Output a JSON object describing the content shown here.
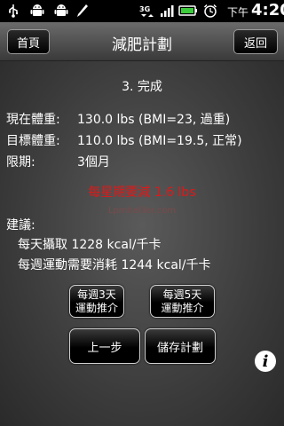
{
  "status_bar": {
    "icons": [
      "usb-icon",
      "android-icon",
      "android-icon",
      "pen-icon",
      "3g-icon",
      "signal-icon",
      "battery-icon",
      "alarm-icon"
    ],
    "network_label": "3G",
    "ampm": "下午",
    "time": "4:20",
    "battery_color": "#3ccc3c"
  },
  "title_bar": {
    "title": "減肥計劃",
    "home_label": "首頁",
    "back_label": "返回"
  },
  "content": {
    "step": "3. 完成",
    "current": {
      "label": "現在體重:",
      "value": "130.0 lbs (BMI=23, 過重)"
    },
    "target": {
      "label": "目標體重:",
      "value": "110.0 lbs (BMI=19.5, 正常)"
    },
    "period": {
      "label": "限期:",
      "value": "3個月"
    },
    "headline": "每星期要減 1.6 lbs",
    "headline_color": "#e01818",
    "watermark": "Lpmhelller.com",
    "advice_title": "建議:",
    "advice_1": "每天攝取 1228 kcal/千卡",
    "advice_2": "每週運動需要消耗 1244 kcal/千卡"
  },
  "buttons": {
    "three_days": [
      "每週3天",
      "運動推介"
    ],
    "five_days": [
      "每週5天",
      "運動推介"
    ],
    "prev": "上一步",
    "save": "儲存計劃"
  },
  "info_icon": {
    "name": "info-icon",
    "glyph": "i"
  }
}
